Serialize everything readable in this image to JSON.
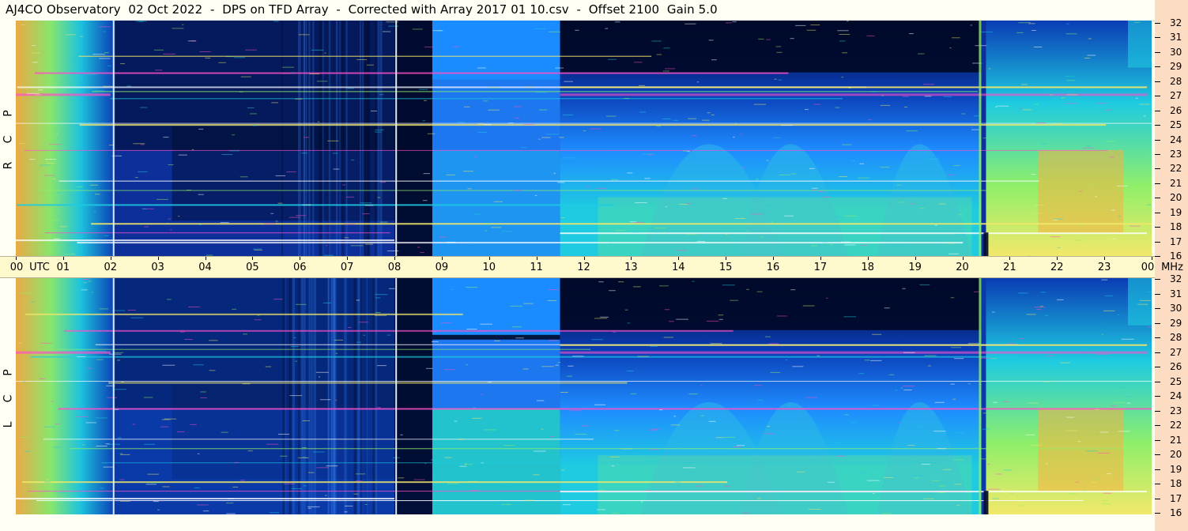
{
  "title": "AJ4CO Observatory  02 Oct 2022  -  DPS on TFD Array  -  Corrected with Array 2017 01 10.csv  -  Offset 2100  Gain 5.0",
  "chart_data": [
    {
      "type": "heatmap",
      "panel": "top",
      "polarization_label": [
        "R",
        "C",
        "P"
      ],
      "x": [
        "00",
        "01",
        "02",
        "03",
        "04",
        "05",
        "06",
        "07",
        "08",
        "09",
        "10",
        "11",
        "12",
        "13",
        "14",
        "15",
        "16",
        "17",
        "18",
        "19",
        "20",
        "21",
        "22",
        "23",
        "00"
      ],
      "x_unit_label": "UTC",
      "y": [
        16,
        17,
        18,
        19,
        20,
        21,
        22,
        23,
        24,
        25,
        26,
        27,
        28,
        29,
        30,
        31,
        32
      ],
      "y_unit_label": "MHz",
      "xlim": [
        0,
        24
      ],
      "ylim": [
        16,
        32
      ]
    },
    {
      "type": "heatmap",
      "panel": "bottom",
      "polarization_label": [
        "L",
        "C",
        "P"
      ],
      "x": [
        "00",
        "01",
        "02",
        "03",
        "04",
        "05",
        "06",
        "07",
        "08",
        "09",
        "10",
        "11",
        "12",
        "13",
        "14",
        "15",
        "16",
        "17",
        "18",
        "19",
        "20",
        "21",
        "22",
        "23",
        "00"
      ],
      "x_unit_label": "UTC",
      "y": [
        16,
        17,
        18,
        19,
        20,
        21,
        22,
        23,
        24,
        25,
        26,
        27,
        28,
        29,
        30,
        31,
        32
      ],
      "y_unit_label": "MHz",
      "xlim": [
        0,
        24
      ],
      "ylim": [
        16,
        32
      ]
    }
  ],
  "colors": {
    "dark": "#000a2a",
    "blue": "#0a3cb4",
    "mid": "#1e8cff",
    "cyan": "#1ecbe1",
    "green": "#8fef6a",
    "yellow": "#f2e86a",
    "orange": "#f7b040",
    "magenta": "#ff50c8"
  }
}
